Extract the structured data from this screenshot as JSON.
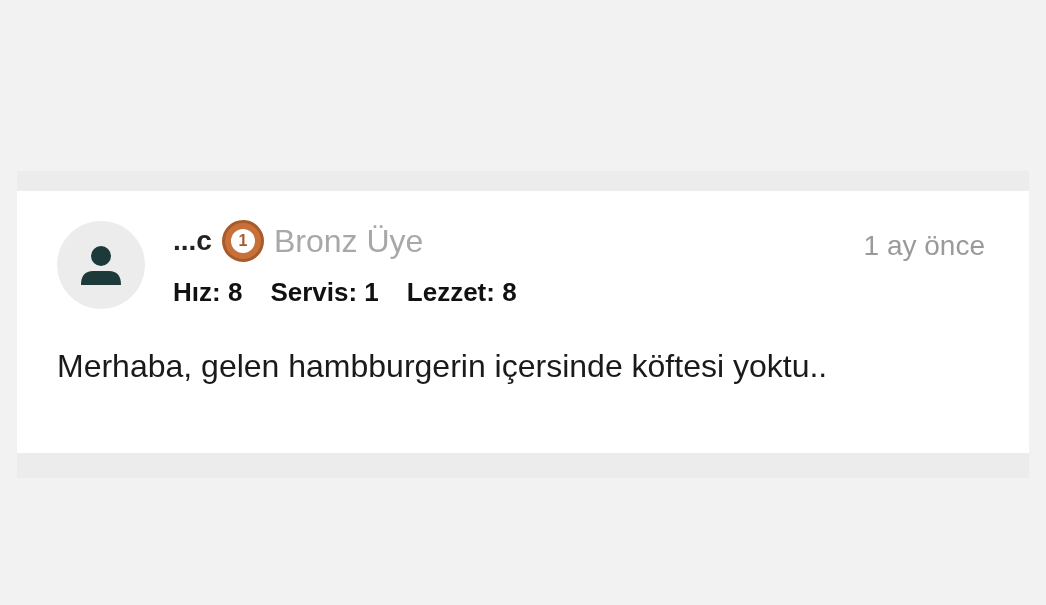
{
  "review": {
    "username": "...c",
    "medal_number": "1",
    "member_level": "Bronz Üye",
    "time": "1 ay önce",
    "ratings": [
      {
        "label": "Hız:",
        "value": "8"
      },
      {
        "label": "Servis:",
        "value": "1"
      },
      {
        "label": "Lezzet:",
        "value": "8"
      }
    ],
    "comment": "Merhaba, gelen hambburgerin içersinde köftesi yoktu.."
  }
}
